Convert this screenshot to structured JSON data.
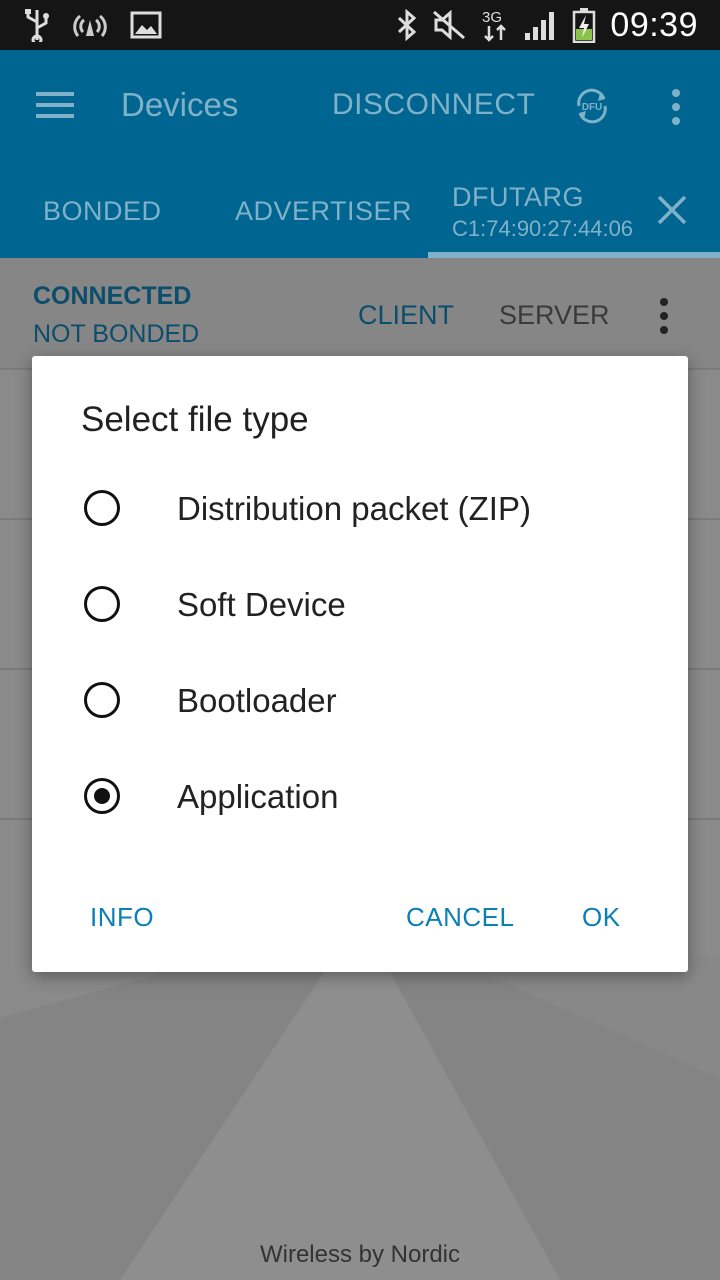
{
  "status_bar": {
    "time": "09:39",
    "network": "3G",
    "icons_left": [
      "usb-icon",
      "wireless-icon",
      "image-icon"
    ],
    "icons_right": [
      "bluetooth-icon",
      "mute-icon",
      "network-icon",
      "signal-icon",
      "battery-charging-icon"
    ]
  },
  "app_bar": {
    "title": "Devices",
    "disconnect_label": "DISCONNECT",
    "dfu_label": "DFU"
  },
  "tabs": [
    {
      "label": "BONDED"
    },
    {
      "label": "ADVERTISER"
    },
    {
      "label": "DFUTARG",
      "sublabel": "C1:74:90:27:44:06",
      "active": true
    }
  ],
  "connection": {
    "state": "CONNECTED",
    "bond_state": "NOT BONDED",
    "client_label": "CLIENT",
    "server_label": "SERVER"
  },
  "dialog": {
    "title": "Select file type",
    "options": [
      {
        "label": "Distribution packet (ZIP)",
        "selected": false
      },
      {
        "label": "Soft Device",
        "selected": false
      },
      {
        "label": "Bootloader",
        "selected": false
      },
      {
        "label": "Application",
        "selected": true
      }
    ],
    "info_label": "INFO",
    "cancel_label": "CANCEL",
    "ok_label": "OK"
  },
  "footer": "Wireless by Nordic",
  "colors": {
    "app_bar": "#006590",
    "accent": "#0b7fb8",
    "scrim": "#8a8a8a"
  }
}
